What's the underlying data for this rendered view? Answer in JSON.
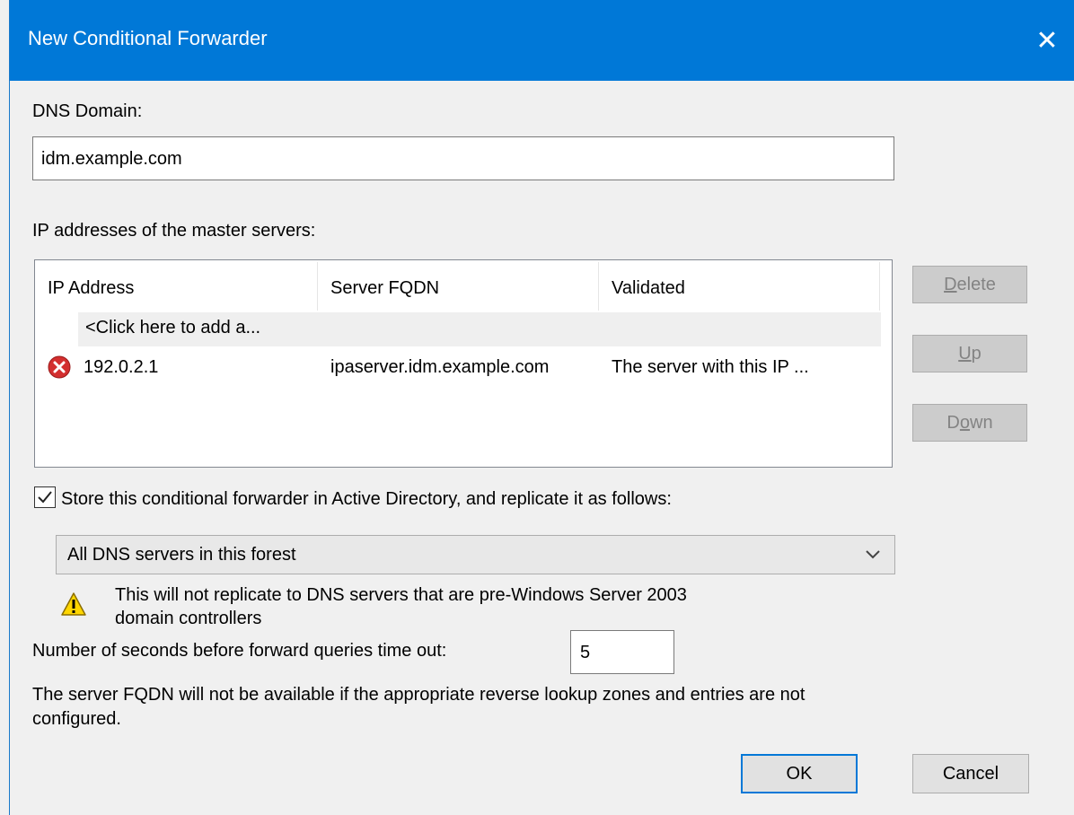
{
  "window": {
    "title": "New Conditional Forwarder",
    "close_glyph": "✕"
  },
  "dns_domain": {
    "label": "DNS Domain:",
    "value": "idm.example.com"
  },
  "master_servers": {
    "label": "IP addresses of the master servers:",
    "columns": [
      "IP Address",
      "Server FQDN",
      "Validated"
    ],
    "add_row_text": "<Click here to add a...",
    "rows": [
      {
        "status_icon": "error-icon",
        "ip": "192.0.2.1",
        "fqdn": "ipaserver.idm.example.com",
        "validated": "The server with this IP ..."
      }
    ]
  },
  "side_buttons": {
    "delete": {
      "pre": "",
      "mnemonic": "D",
      "post": "elete"
    },
    "up": {
      "pre": "",
      "mnemonic": "U",
      "post": "p"
    },
    "down": {
      "pre": "D",
      "mnemonic": "o",
      "post": "wn"
    }
  },
  "store_ad": {
    "checked": true,
    "label": "Store this conditional forwarder in Active Directory, and replicate it as follows:"
  },
  "replication": {
    "selected": "All DNS servers in this forest"
  },
  "warning": {
    "icon": "warning-icon",
    "line1": "This will not replicate to DNS servers that are pre-Windows Server 2003",
    "line2": "domain controllers"
  },
  "timeout": {
    "label": "Number of seconds before forward queries time out:",
    "value": "5"
  },
  "note": {
    "line1": "The server FQDN will not be available if the appropriate reverse lookup zones and entries are not",
    "line2": "configured."
  },
  "buttons": {
    "ok": "OK",
    "cancel": "Cancel"
  },
  "colors": {
    "titlebar": "#0078d7",
    "accent": "#0078d7",
    "error": "#d32f2f",
    "warning": "#ffd600"
  }
}
